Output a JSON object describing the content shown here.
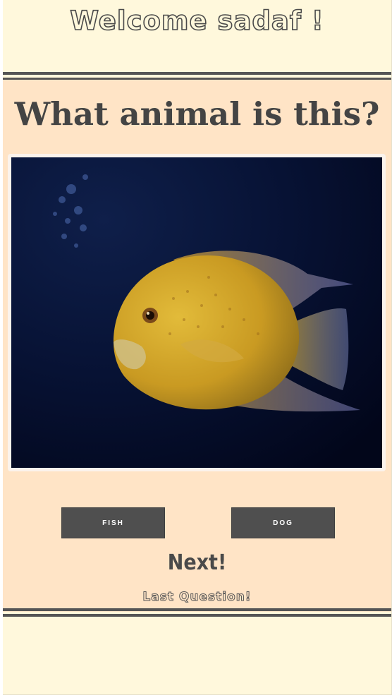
{
  "header": {
    "welcome_text": "Welcome sadaf !"
  },
  "quiz": {
    "question": "What animal is this?",
    "image": {
      "subject": "fish",
      "description_icon": "fish-photo"
    },
    "answers": [
      {
        "label": "FISH"
      },
      {
        "label": "DOG"
      }
    ],
    "next_label": "Next!",
    "status_text": "Last Question!"
  },
  "colors": {
    "page_background": "#fff8dc",
    "quiz_background": "#ffe4c6",
    "divider": "#555555",
    "button": "#4f4f4f",
    "text_dark": "#444444"
  }
}
